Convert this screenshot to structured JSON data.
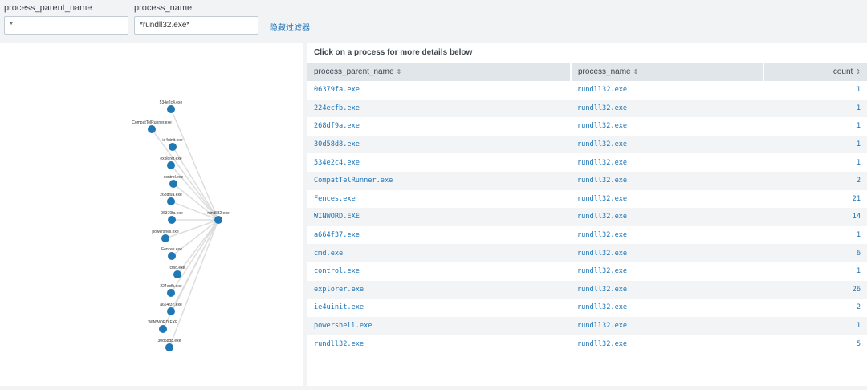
{
  "filters": {
    "parent": {
      "label": "process_parent_name",
      "value": "*"
    },
    "process": {
      "label": "process_name",
      "value": "*rundll32.exe*"
    },
    "hide_link": "隐藏过滤器"
  },
  "details": {
    "title": "Click on a process for more details below",
    "columns": [
      "process_parent_name",
      "process_name",
      "count"
    ],
    "rows": [
      [
        "06379fa.exe",
        "rundll32.exe",
        "1"
      ],
      [
        "224ecfb.exe",
        "rundll32.exe",
        "1"
      ],
      [
        "268df9a.exe",
        "rundll32.exe",
        "1"
      ],
      [
        "30d58d8.exe",
        "rundll32.exe",
        "1"
      ],
      [
        "534e2c4.exe",
        "rundll32.exe",
        "1"
      ],
      [
        "CompatTelRunner.exe",
        "rundll32.exe",
        "2"
      ],
      [
        "Fences.exe",
        "rundll32.exe",
        "21"
      ],
      [
        "WINWORD.EXE",
        "rundll32.exe",
        "14"
      ],
      [
        "a664f37.exe",
        "rundll32.exe",
        "1"
      ],
      [
        "cmd.exe",
        "rundll32.exe",
        "6"
      ],
      [
        "control.exe",
        "rundll32.exe",
        "1"
      ],
      [
        "explorer.exe",
        "rundll32.exe",
        "26"
      ],
      [
        "ie4uinit.exe",
        "rundll32.exe",
        "2"
      ],
      [
        "powershell.exe",
        "rundll32.exe",
        "1"
      ],
      [
        "rundll32.exe",
        "rundll32.exe",
        "5"
      ]
    ]
  },
  "graph": {
    "node_color": "#1f77b4",
    "edge_color": "#dddddd",
    "target": "rundll32.exe",
    "sources": [
      "534e2c4.exe",
      "CompatTelRunner.exe",
      "ie4uinit.exe",
      "explorer.exe",
      "control.exe",
      "268df9a.exe",
      "06379fa.exe",
      "powershell.exe",
      "Fences.exe",
      "cmd.exe",
      "224ecfb.exe",
      "a664f37.exe",
      "WINWORD.EXE",
      "30d58d8.exe"
    ]
  }
}
